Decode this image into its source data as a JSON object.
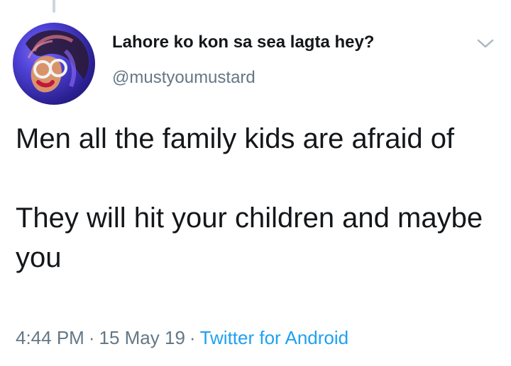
{
  "tweet": {
    "author": {
      "display_name": "Lahore ko kon sa sea lagta hey?",
      "handle": "@mustyoumustard",
      "avatar_icon": "avatar-illustration-icon"
    },
    "text": "Men all the family kids are afraid of\n\nThey will hit your children and maybe you",
    "time": "4:44 PM",
    "date": "15 May 19",
    "source": "Twitter for Android",
    "separator": "·"
  },
  "icons": {
    "menu": "chevron-down-icon"
  },
  "colors": {
    "text_primary": "#14171a",
    "text_secondary": "#657786",
    "link": "#1da1f2",
    "thread_line": "#ccd6dd"
  }
}
